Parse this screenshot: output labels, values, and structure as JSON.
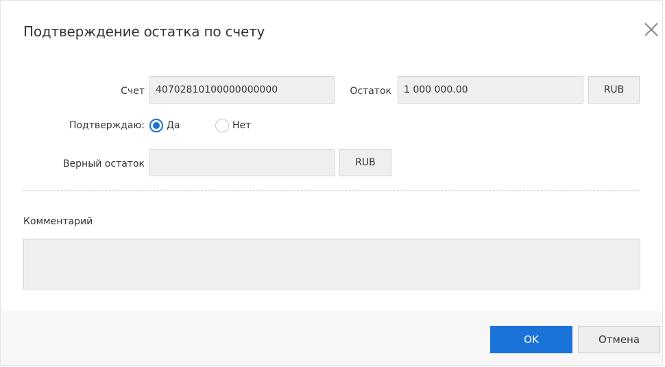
{
  "dialog": {
    "title": "Подтверждение остатка по счету"
  },
  "form": {
    "account_label": "Счет",
    "account_value": "40702810100000000000",
    "balance_label": "Остаток",
    "balance_value": "1 000 000.00",
    "balance_currency": "RUB",
    "confirm_label": "Подтверждаю:",
    "confirm_options": [
      {
        "label": "Да",
        "checked": true
      },
      {
        "label": "Нет",
        "checked": false
      }
    ],
    "correct_balance_label": "Верный остаток",
    "correct_balance_value": "",
    "correct_balance_currency": "RUB",
    "comment_label": "Комментарий",
    "comment_value": ""
  },
  "footer": {
    "ok_label": "OK",
    "cancel_label": "Отмена"
  },
  "colors": {
    "accent": "#1a73d9",
    "field_bg": "#efefef",
    "footer_bg": "#f7f7f7"
  },
  "icons": {
    "close": "close-icon"
  }
}
